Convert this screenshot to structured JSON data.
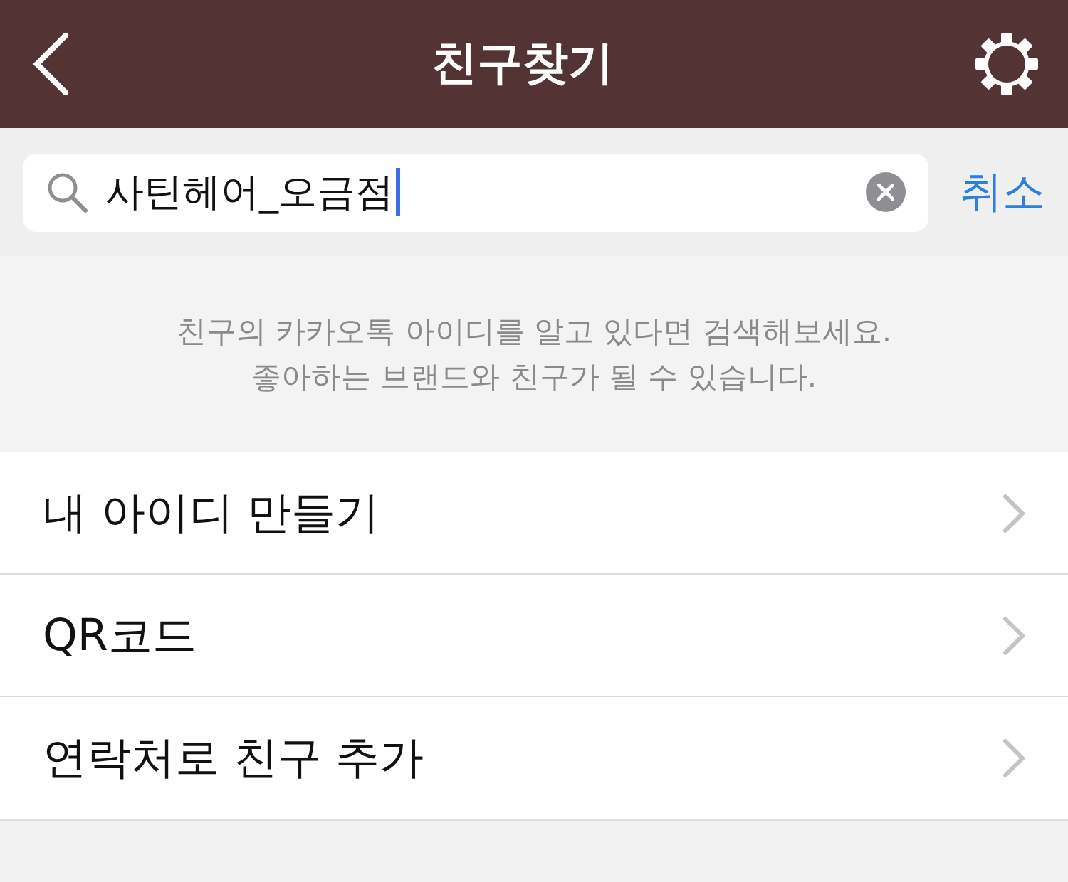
{
  "header": {
    "title": "친구찾기"
  },
  "search": {
    "value": "사틴헤어_오금점",
    "cancel": "취소"
  },
  "info": [
    "친구의 카카오톡 아이디를 알고 있다면 검색해보세요.",
    "좋아하는 브랜드와 친구가 될 수 있습니다."
  ],
  "menu": [
    {
      "label": "내 아이디 만들기"
    },
    {
      "label": "QR코드"
    },
    {
      "label": "연락처로 친구 추가"
    }
  ]
}
